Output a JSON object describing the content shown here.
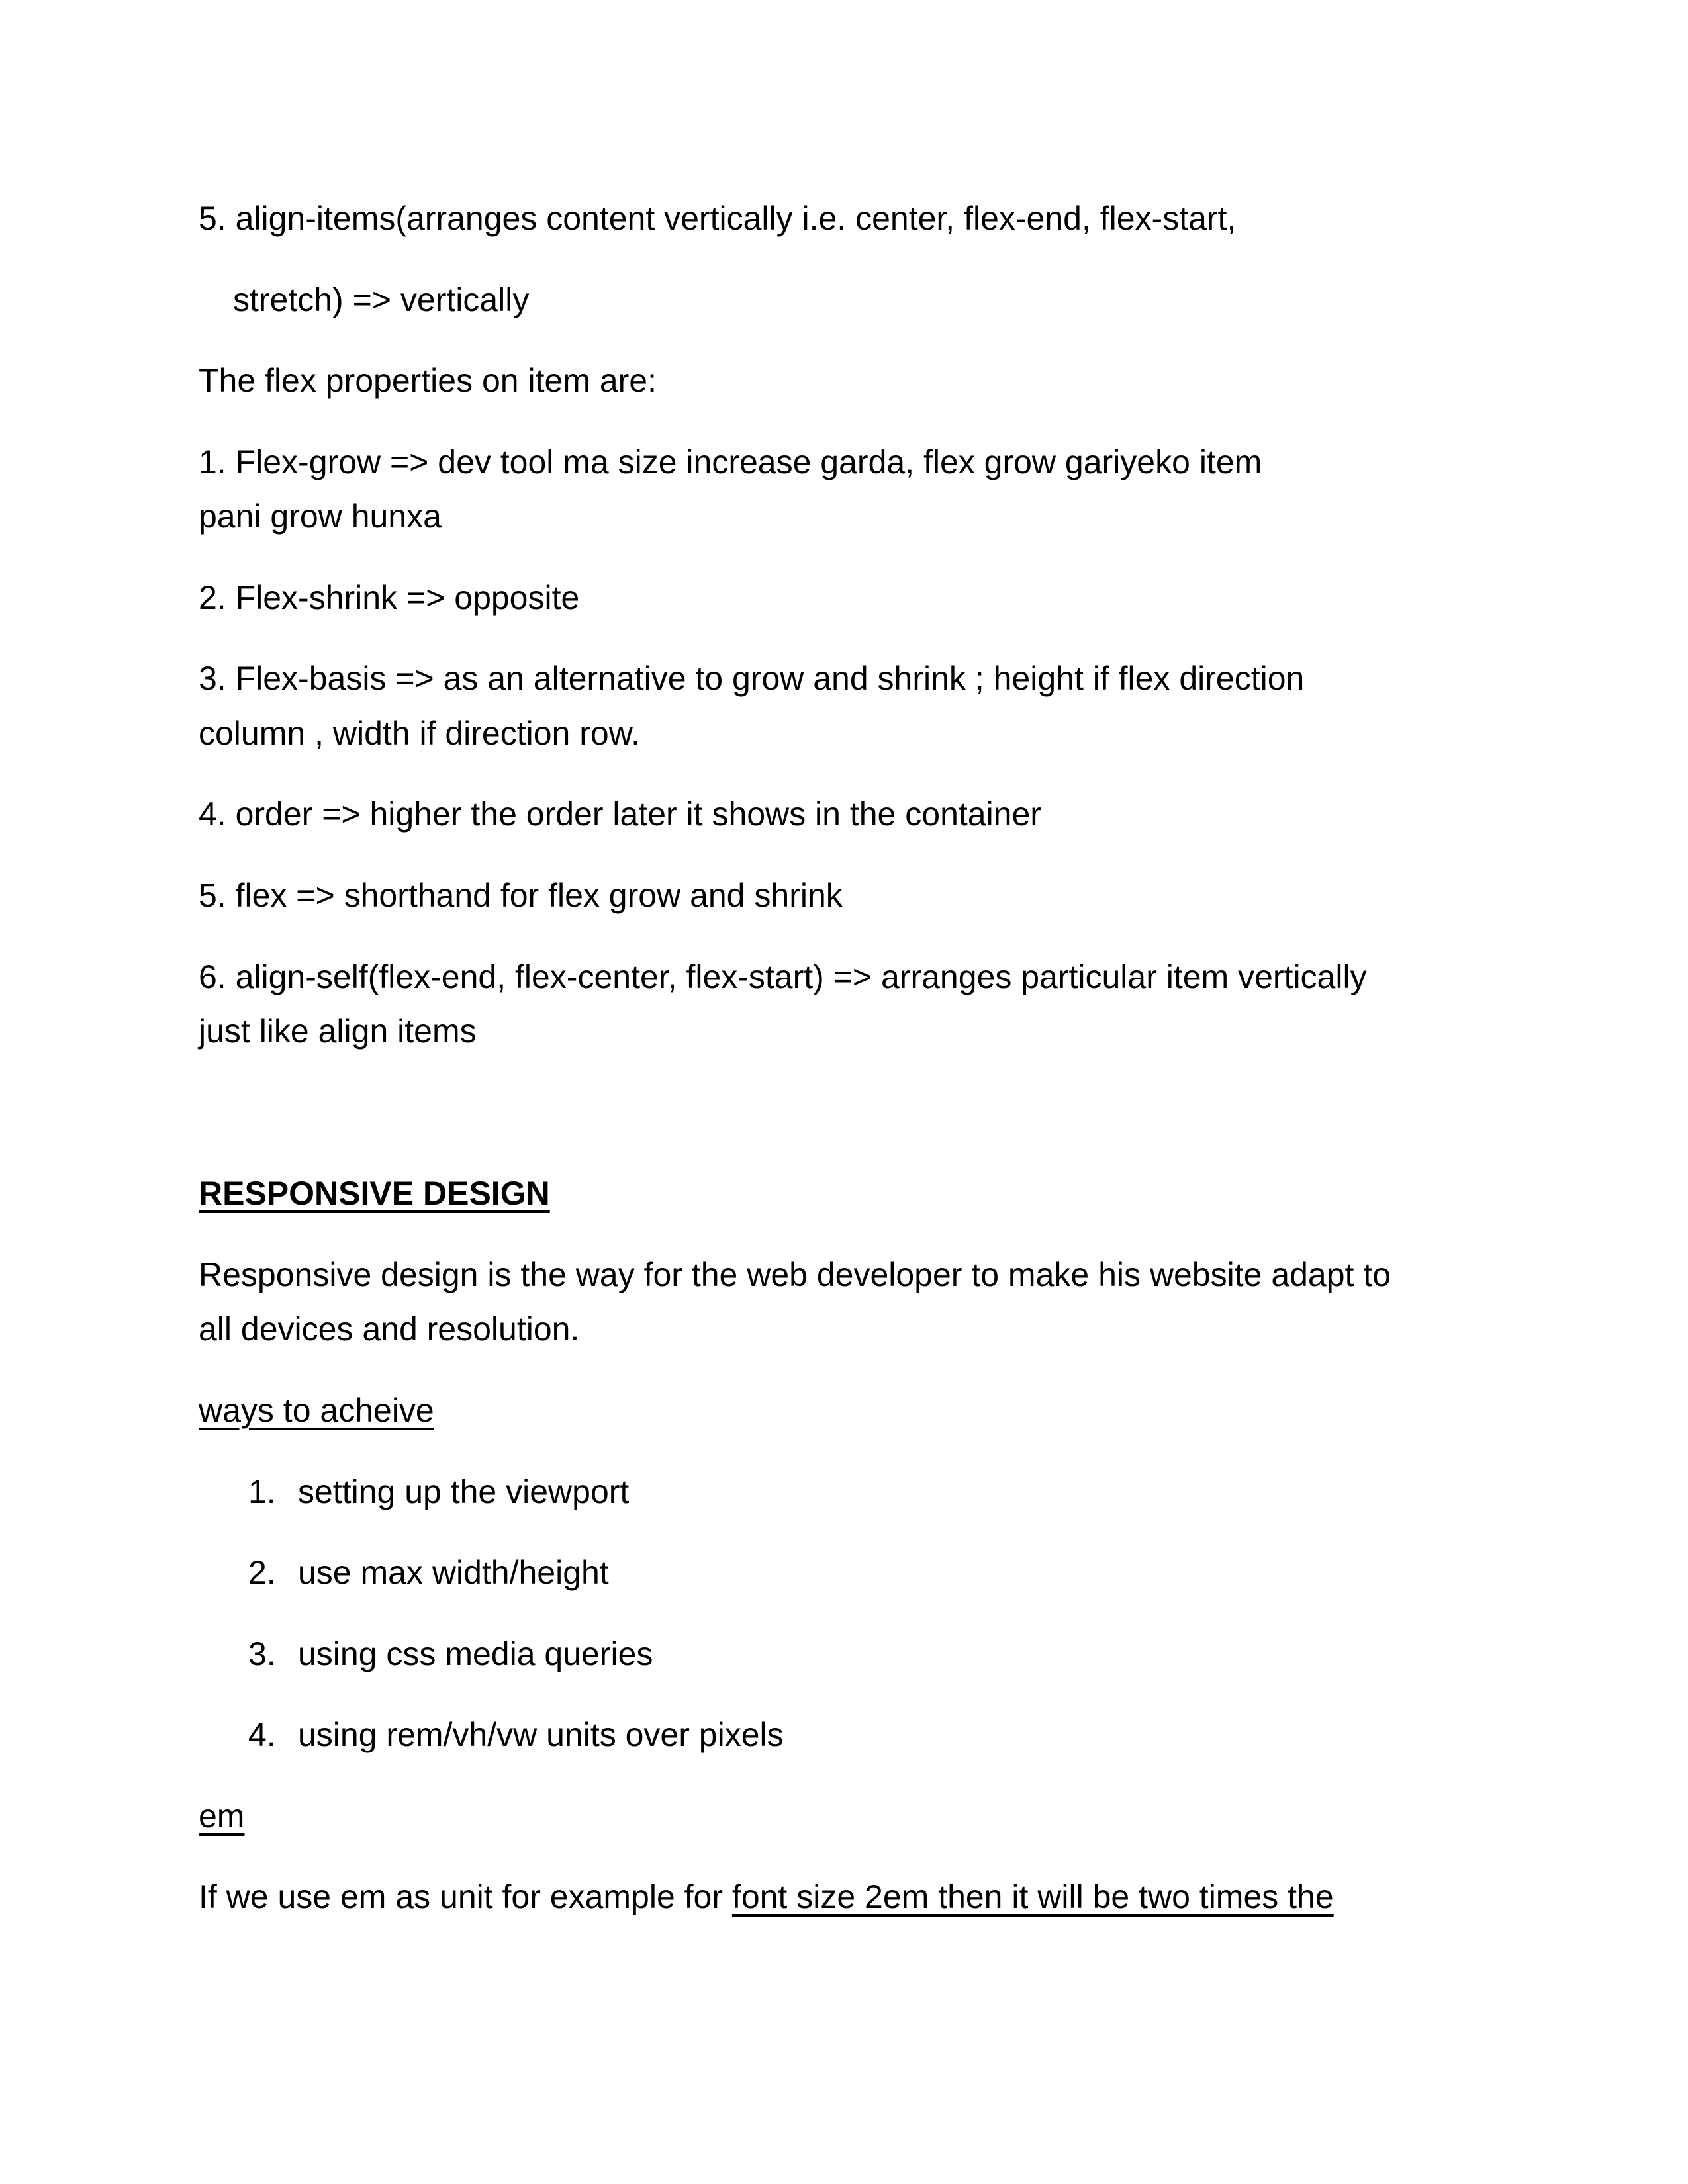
{
  "flex_container": {
    "item5_line1": "5. align-items(arranges content vertically i.e. center, flex-end, flex-start,",
    "item5_line2": "stretch) => vertically"
  },
  "flex_item": {
    "intro": "The flex properties on item are:",
    "item1_line1": "1. Flex-grow => dev tool ma size increase garda, flex grow gariyeko item",
    "item1_line2": "pani grow hunxa",
    "item2": "2. Flex-shrink => opposite",
    "item3_line1": "3. Flex-basis => as an alternative to grow and shrink ; height if flex direction",
    "item3_line2": "column , width if direction row.",
    "item4": "4. order => higher the order later it shows in the container",
    "item5": "5. flex => shorthand for flex grow and shrink",
    "item6_line1": "6. align-self(flex-end, flex-center, flex-start) => arranges particular item vertically",
    "item6_line2": "just like align items"
  },
  "responsive": {
    "heading": "RESPONSIVE DESIGN",
    "desc_line1": "Responsive design is the way for the web developer to make his website adapt to",
    "desc_line2": "all devices and resolution.",
    "ways_heading": "ways to acheive",
    "ways": [
      {
        "num": "1.",
        "text": "setting up the viewport"
      },
      {
        "num": "2.",
        "text": "use max width/height"
      },
      {
        "num": "3.",
        "text": "using css media queries"
      },
      {
        "num": "4.",
        "text": "using rem/vh/vw units over pixels"
      }
    ]
  },
  "em_section": {
    "heading": "em",
    "line1_plain": "If we use em as unit for example for ",
    "line1_underlined": "font size 2em then it will be two times the "
  }
}
